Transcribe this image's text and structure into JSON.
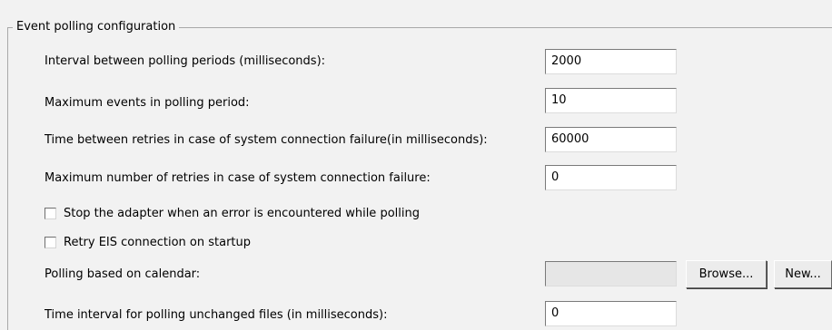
{
  "group": {
    "title": "Event polling configuration"
  },
  "fields": {
    "interval": {
      "label": "Interval between polling periods (milliseconds):",
      "value": "2000"
    },
    "max_events": {
      "label": "Maximum events in polling period:",
      "value": "10"
    },
    "retry_time": {
      "label": "Time between retries in case of system connection failure(in milliseconds):",
      "value": "60000"
    },
    "max_retries": {
      "label": "Maximum number of retries in case of system connection failure:",
      "value": "0"
    },
    "calendar": {
      "label": "Polling based on calendar:",
      "value": ""
    },
    "unchanged_interval": {
      "label": "Time interval for polling unchanged files (in milliseconds):",
      "value": "0"
    }
  },
  "checkboxes": {
    "stop_adapter": {
      "label": "Stop the adapter when an error is encountered while polling",
      "checked": false
    },
    "retry_eis": {
      "label": "Retry EIS connection on startup",
      "checked": false
    }
  },
  "buttons": {
    "browse": "Browse...",
    "new": "New..."
  }
}
